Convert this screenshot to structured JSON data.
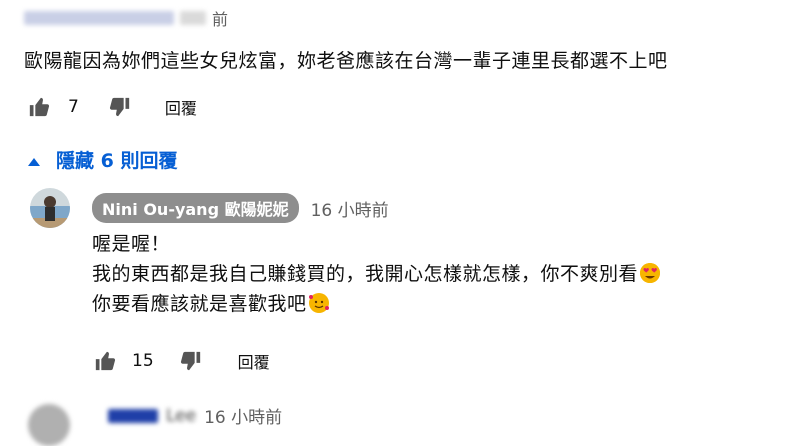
{
  "top_comment": {
    "time_suffix": "前",
    "text": "歐陽龍因為妳們這些女兒炫富，妳老爸應該在台灣一輩子連里長都選不上吧",
    "likes": "7",
    "reply_label": "回覆"
  },
  "replies_toggle": {
    "icon": "caret-up-icon",
    "label": "隱藏 6 則回覆"
  },
  "reply": {
    "author": "Nini Ou-yang 歐陽妮妮",
    "time": "16 小時前",
    "line1": "喔是喔！",
    "line2": "我的東西都是我自己賺錢買的，我開心怎樣就怎樣，你不爽別看",
    "line3": "你要看應該就是喜歡我吧",
    "likes": "15",
    "reply_label": "回覆"
  },
  "next_reply": {
    "author_fragment": "Lee",
    "time": "16 小時前"
  },
  "colors": {
    "link_blue": "#065fd4",
    "chip_gray": "#8e8e8e",
    "meta_gray": "#606060"
  }
}
